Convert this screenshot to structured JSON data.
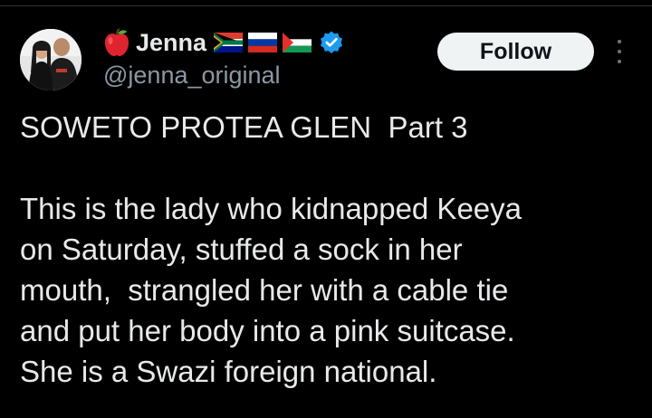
{
  "author": {
    "display_name": "Jenna",
    "handle": "@jenna_original",
    "name_emoji": "apple-icon",
    "flags": [
      "south-africa-flag",
      "russia-flag",
      "palestine-flag"
    ],
    "verified": true
  },
  "actions": {
    "follow_label": "Follow",
    "more_icon": "more-vertical-icon"
  },
  "tweet": {
    "lines": [
      "SOWETO PROTEA GLEN  Part 3",
      "",
      "This is the lady who kidnapped Keeya",
      "on Saturday, stuffed a sock in her",
      "mouth,  strangled her with a cable tie",
      "and put her body into a pink suitcase.",
      "She is a Swazi foreign national."
    ]
  },
  "colors": {
    "background": "#000000",
    "text": "#e7e9ea",
    "secondary_text": "#8b98a5",
    "follow_button_bg": "#eff3f4",
    "verified_blue": "#1d9bf0"
  }
}
